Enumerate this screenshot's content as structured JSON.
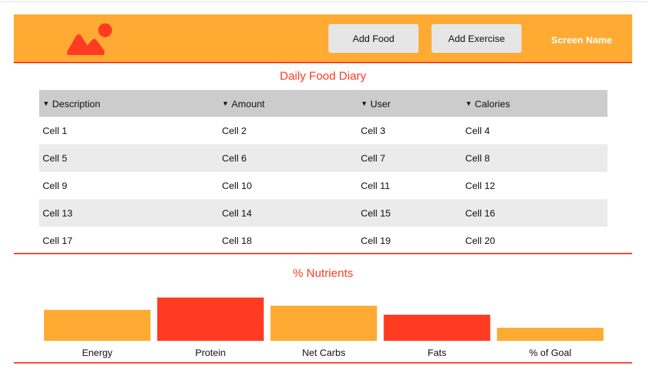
{
  "header": {
    "logo_icon": "image-placeholder-icon",
    "add_food_label": "Add Food",
    "add_exercise_label": "Add Exercise",
    "screen_name": "Screen Name"
  },
  "diary": {
    "title": "Daily Food Diary",
    "columns": [
      "Description",
      "Amount",
      "User",
      "Calories"
    ],
    "rows": [
      [
        "Cell 1",
        "Cell 2",
        "Cell 3",
        "Cell 4"
      ],
      [
        "Cell 5",
        "Cell 6",
        "Cell 7",
        "Cell 8"
      ],
      [
        "Cell 9",
        "Cell 10",
        "Cell 11",
        "Cell 12"
      ],
      [
        "Cell 13",
        "Cell 14",
        "Cell 15",
        "Cell 16"
      ],
      [
        "Cell 17",
        "Cell 18",
        "Cell 19",
        "Cell 20"
      ]
    ]
  },
  "nutrients": {
    "title": "% Nutrients"
  },
  "colors": {
    "accent_orange": "#ffaa33",
    "accent_red": "#ff3b22"
  },
  "chart_data": {
    "type": "bar",
    "categories": [
      "Energy",
      "Protein",
      "Net Carbs",
      "Fats",
      "% of Goal"
    ],
    "values": [
      45,
      63,
      51,
      38,
      19
    ],
    "ylim": [
      0,
      70
    ],
    "colors": [
      "#ffaa33",
      "#ff3b22",
      "#ffaa33",
      "#ff3b22",
      "#ffaa33"
    ],
    "grid": false
  }
}
